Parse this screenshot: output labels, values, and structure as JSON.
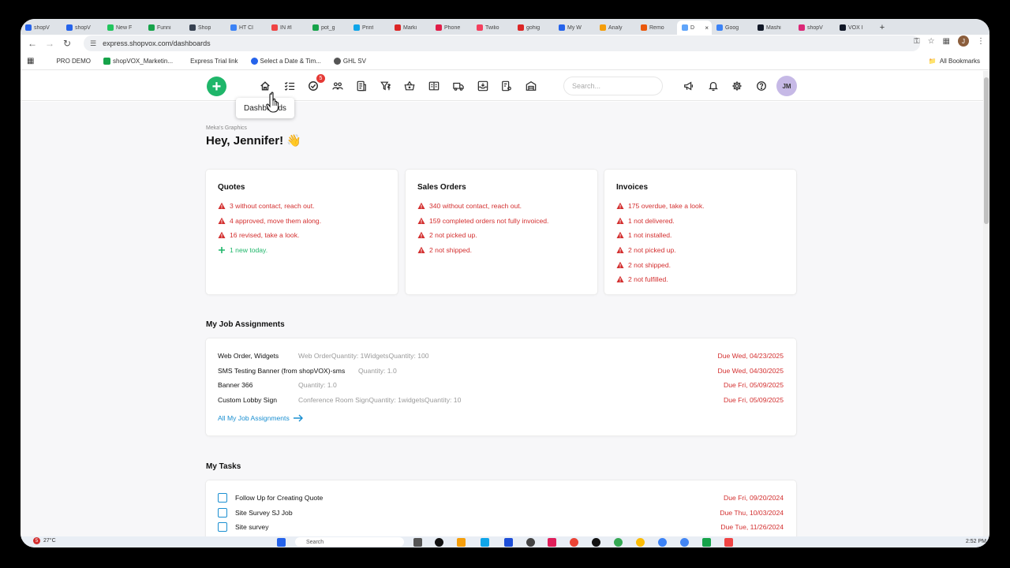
{
  "browser": {
    "tabs": [
      {
        "title": "shopV",
        "color": "#2563eb"
      },
      {
        "title": "shopV",
        "color": "#2563eb"
      },
      {
        "title": "New F",
        "color": "#22c55e"
      },
      {
        "title": "Funni",
        "color": "#16a34a"
      },
      {
        "title": "Shop",
        "color": "#374151"
      },
      {
        "title": "HT Cl",
        "color": "#3b82f6"
      },
      {
        "title": "IN #I",
        "color": "#ef4444"
      },
      {
        "title": "pot_g",
        "color": "#16a34a"
      },
      {
        "title": "Print",
        "color": "#0ea5e9"
      },
      {
        "title": "Marki",
        "color": "#dc2626"
      },
      {
        "title": "Phone",
        "color": "#e11d48"
      },
      {
        "title": "Twilio",
        "color": "#f43f5e"
      },
      {
        "title": "gohig",
        "color": "#dc2626"
      },
      {
        "title": "My W",
        "color": "#2563eb"
      },
      {
        "title": "Analy",
        "color": "#f59e0b"
      },
      {
        "title": "Remo",
        "color": "#ea580c"
      },
      {
        "title": "D",
        "color": "#60a5fa",
        "active": true
      },
      {
        "title": "Goog",
        "color": "#3b82f6"
      },
      {
        "title": "Mashi",
        "color": "#111827"
      },
      {
        "title": "shopV",
        "color": "#db2777"
      },
      {
        "title": "VOX I",
        "color": "#111827"
      }
    ],
    "url": "express.shopvox.com/dashboards",
    "bookmarks": [
      {
        "label": "PRO DEMO"
      },
      {
        "label": "shopVOX_Marketin..."
      },
      {
        "label": "Express Trial link"
      },
      {
        "label": "Select a Date & Tim..."
      },
      {
        "label": "GHL SV"
      }
    ],
    "all_bookmarks": "All Bookmarks",
    "profile_initial": "J"
  },
  "header": {
    "badge_count": "5",
    "search_placeholder": "Search...",
    "avatar": "JM",
    "tooltip": "Dashboards"
  },
  "page": {
    "org": "Meka's Graphics",
    "greeting": "Hey, Jennifer! 👋"
  },
  "cards": {
    "quotes": {
      "title": "Quotes",
      "items": [
        {
          "text": "3 without contact, reach out.",
          "kind": "warn"
        },
        {
          "text": "4 approved, move them along.",
          "kind": "warn"
        },
        {
          "text": "16 revised, take a look.",
          "kind": "warn"
        },
        {
          "text": "1 new today.",
          "kind": "new"
        }
      ]
    },
    "sales_orders": {
      "title": "Sales Orders",
      "items": [
        {
          "text": "340 without contact, reach out.",
          "kind": "warn"
        },
        {
          "text": "159 completed orders not fully invoiced.",
          "kind": "warn"
        },
        {
          "text": "2 not picked up.",
          "kind": "warn"
        },
        {
          "text": "2 not shipped.",
          "kind": "warn"
        }
      ]
    },
    "invoices": {
      "title": "Invoices",
      "items": [
        {
          "text": "175 overdue, take a look.",
          "kind": "warn"
        },
        {
          "text": "1 not delivered.",
          "kind": "warn"
        },
        {
          "text": "1 not installed.",
          "kind": "warn"
        },
        {
          "text": "2 not picked up.",
          "kind": "warn"
        },
        {
          "text": "2 not shipped.",
          "kind": "warn"
        },
        {
          "text": "2 not fulfilled.",
          "kind": "warn"
        }
      ]
    }
  },
  "jobs": {
    "title": "My Job Assignments",
    "rows": [
      {
        "name": "Web Order, Widgets",
        "desc": "Web OrderQuantity: 1WidgetsQuantity: 100",
        "due": "Due Wed, 04/23/2025"
      },
      {
        "name": "SMS Testing Banner (from shopVOX)-sms",
        "desc": "Quantity: 1.0",
        "due": "Due Wed, 04/30/2025"
      },
      {
        "name": "Banner 366",
        "desc": "Quantity: 1.0",
        "due": "Due Fri, 05/09/2025"
      },
      {
        "name": "Custom Lobby Sign",
        "desc": "Conference Room SignQuantity: 1widgetsQuantity: 10",
        "due": "Due Fri, 05/09/2025"
      }
    ],
    "all_link": "All My Job Assignments"
  },
  "tasks": {
    "title": "My Tasks",
    "rows": [
      {
        "name": "Follow Up for Creating Quote",
        "due": "Due Fri, 09/20/2024"
      },
      {
        "name": "Site Survey SJ Job",
        "due": "Due Thu, 10/03/2024"
      },
      {
        "name": "Site survey",
        "due": "Due Tue, 11/26/2024"
      }
    ]
  },
  "taskbar": {
    "weather_badge": "5",
    "temperature": "27°C",
    "search": "Search",
    "time": "2:52 PM"
  },
  "colors": {
    "accent_green": "#1fb66a",
    "alert_red": "#d32f2f",
    "link_blue": "#1a8fd1"
  }
}
